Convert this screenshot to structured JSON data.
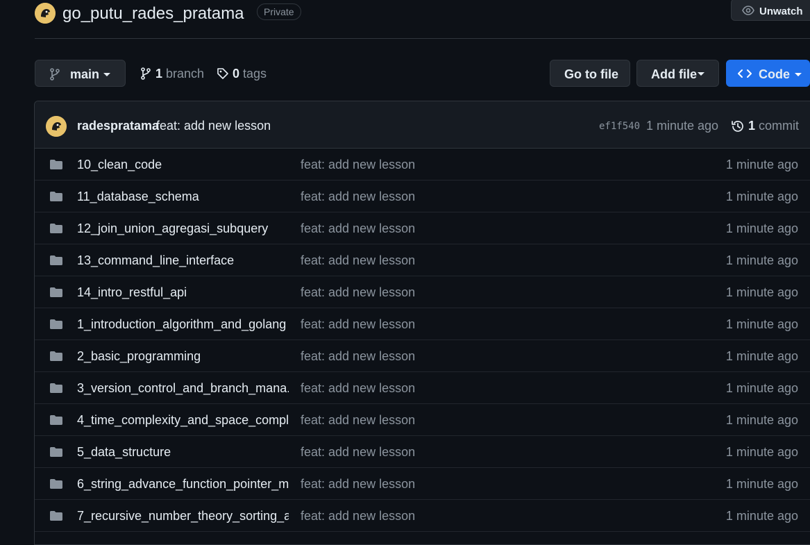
{
  "repo": {
    "name": "go_putu_rades_pratama",
    "visibility": "Private",
    "watch_label": "Unwatch"
  },
  "toolbar": {
    "branch": "main",
    "branch_count": "1",
    "branch_word": "branch",
    "tag_count": "0",
    "tag_word": "tags",
    "goto_file": "Go to file",
    "add_file": "Add file",
    "code": "Code"
  },
  "latest_commit": {
    "author": "radespratama",
    "message": "feat: add new lesson",
    "sha": "ef1f540",
    "time": "1 minute ago",
    "count": "1",
    "count_word": "commit"
  },
  "files": [
    {
      "name": "10_clean_code",
      "message": "feat: add new lesson",
      "age": "1 minute ago"
    },
    {
      "name": "11_database_schema",
      "message": "feat: add new lesson",
      "age": "1 minute ago"
    },
    {
      "name": "12_join_union_agregasi_subquery",
      "message": "feat: add new lesson",
      "age": "1 minute ago"
    },
    {
      "name": "13_command_line_interface",
      "message": "feat: add new lesson",
      "age": "1 minute ago"
    },
    {
      "name": "14_intro_restful_api",
      "message": "feat: add new lesson",
      "age": "1 minute ago"
    },
    {
      "name": "1_introduction_algorithm_and_golang",
      "message": "feat: add new lesson",
      "age": "1 minute ago"
    },
    {
      "name": "2_basic_programming",
      "message": "feat: add new lesson",
      "age": "1 minute ago"
    },
    {
      "name": "3_version_control_and_branch_mana...",
      "message": "feat: add new lesson",
      "age": "1 minute ago"
    },
    {
      "name": "4_time_complexity_and_space_compl...",
      "message": "feat: add new lesson",
      "age": "1 minute ago"
    },
    {
      "name": "5_data_structure",
      "message": "feat: add new lesson",
      "age": "1 minute ago"
    },
    {
      "name": "6_string_advance_function_pointer_m...",
      "message": "feat: add new lesson",
      "age": "1 minute ago"
    },
    {
      "name": "7_recursive_number_theory_sorting_a...",
      "message": "feat: add new lesson",
      "age": "1 minute ago"
    }
  ],
  "colors": {
    "background": "#0d1117",
    "accent": "#1f6feb",
    "muted_text": "#8b949e",
    "folder_icon": "#8b949e"
  },
  "icons": [
    "avatar",
    "eye-icon",
    "git-branch-icon",
    "tag-icon",
    "history-icon",
    "folder-icon",
    "code-icon",
    "caret-down-icon"
  ]
}
